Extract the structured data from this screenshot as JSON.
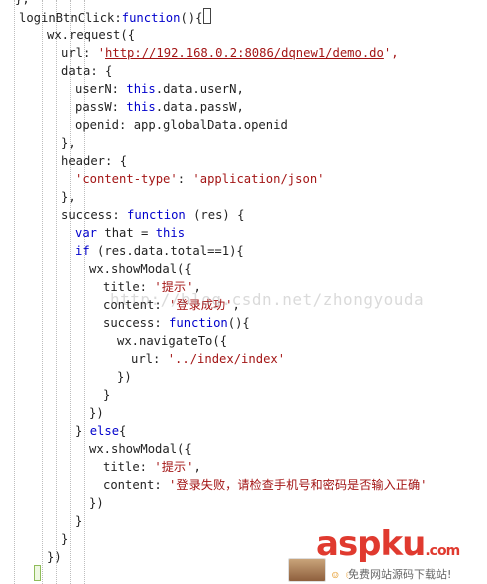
{
  "code": {
    "l0": "};",
    "l1_name": "loginBtnClick",
    "l1_colon": ":",
    "l1_kw": "function",
    "l1_rest": "(){",
    "l2": "wx.request({",
    "l3_key": "url: ",
    "l3_q1": "'",
    "l3_url": "http://192.168.0.2:8086/dqnew1/demo.do",
    "l3_q2": "',",
    "l4": "data: {",
    "l5_key": "userN: ",
    "l5_kw": "this",
    "l5_rest": ".data.userN,",
    "l6_key": "passW: ",
    "l6_kw": "this",
    "l6_rest": ".data.passW,",
    "l7": "openid: app.globalData.openid",
    "l8": "},",
    "l9": "header: {",
    "l10_key": "'content-type'",
    "l10_mid": ": ",
    "l10_val": "'application/json'",
    "l11": "},",
    "l12_key": "success: ",
    "l12_kw": "function",
    "l12_rest": " (res) {",
    "l13_kw": "var",
    "l13_mid": " that = ",
    "l13_kw2": "this",
    "l14_kw": "if",
    "l14_rest": " (res.data.total==1){",
    "l15": "wx.showModal({",
    "l16_key": "title: ",
    "l16_val": "'提示'",
    "l16_end": ",",
    "l17_key": "content: ",
    "l17_val": "'登录成功'",
    "l17_end": ",",
    "l18_key": "success: ",
    "l18_kw": "function",
    "l18_rest": "(){",
    "l19": "wx.navigateTo({",
    "l20_key": "url: ",
    "l20_val": "'../index/index'",
    "l21": "})",
    "l22": "}",
    "l23": "})",
    "l24_a": "} ",
    "l24_kw": "else",
    "l24_b": "{",
    "l25": "wx.showModal({",
    "l26_key": "title: ",
    "l26_val": "'提示'",
    "l26_end": ",",
    "l27_key": "content: ",
    "l27_val": "'登录失败，请检查手机号和密码是否输入正确'",
    "l28": "})",
    "l29": "}",
    "l30": "}",
    "l31": "})"
  },
  "watermark": "http://blog.csdn.net/zhongyouda",
  "brand": {
    "logo": "aspku",
    "logo_suffix": ".com",
    "tagline": "免费网站源码下载站!"
  },
  "colors": {
    "keyword": "#0000cc",
    "string": "#a31515",
    "text": "#222222",
    "brand": "#e03a2f"
  }
}
